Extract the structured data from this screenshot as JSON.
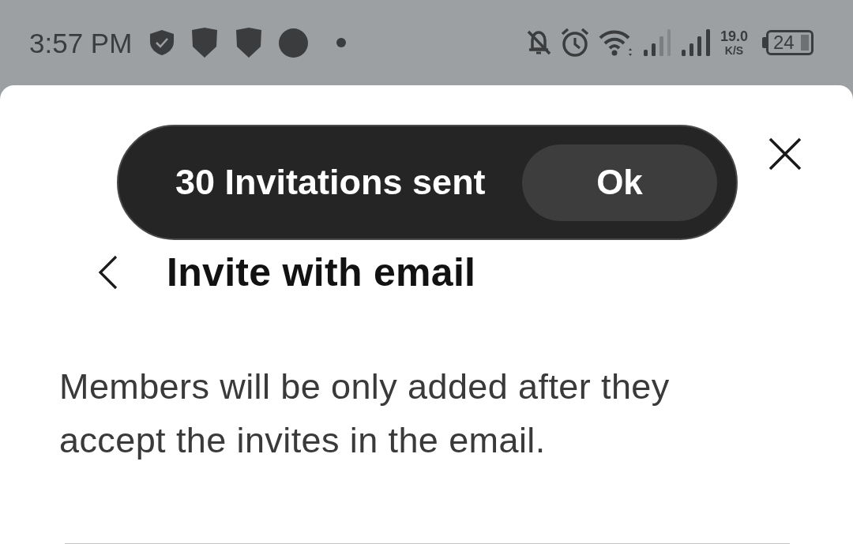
{
  "status_bar": {
    "time": "3:57 PM",
    "network_speed": "19.0",
    "network_unit": "K/S",
    "battery": "24"
  },
  "toast": {
    "message": "30 Invitations sent",
    "action": "Ok"
  },
  "header": {
    "title": "Invite with email"
  },
  "description": "Members will be only added after they accept the invites in the email."
}
